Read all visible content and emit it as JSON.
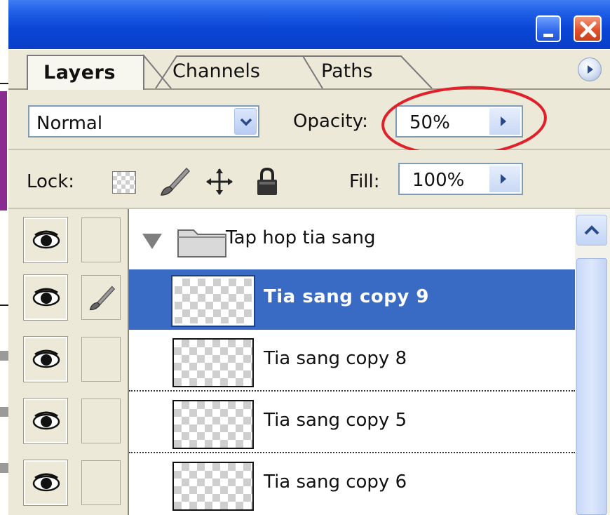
{
  "window": {
    "controls": {
      "minimize_icon": "minimize-icon",
      "close_icon": "close-icon"
    }
  },
  "tabs": [
    {
      "label": "Layers",
      "active": true
    },
    {
      "label": "Channels",
      "active": false
    },
    {
      "label": "Paths",
      "active": false
    }
  ],
  "blend_mode": {
    "value": "Normal"
  },
  "opacity": {
    "label": "Opacity:",
    "value": "50%",
    "highlighted": true,
    "highlight_color": "#e0202a"
  },
  "lock": {
    "label": "Lock:"
  },
  "fill": {
    "label": "Fill:",
    "value": "100%"
  },
  "group": {
    "name": "Tap hop tia sang",
    "expanded": true
  },
  "layers": [
    {
      "name": "Tia sang copy 9",
      "selected": true,
      "visible": true,
      "linked_brush": true
    },
    {
      "name": "Tia sang copy 8",
      "selected": false,
      "visible": true
    },
    {
      "name": "Tia sang copy 5",
      "selected": false,
      "visible": true
    },
    {
      "name": "Tia sang copy 6",
      "selected": false,
      "visible": true
    }
  ],
  "colors": {
    "selection": "#3a6bc4",
    "titlebar": "#0a45d6",
    "panel": "#ece9d8"
  }
}
